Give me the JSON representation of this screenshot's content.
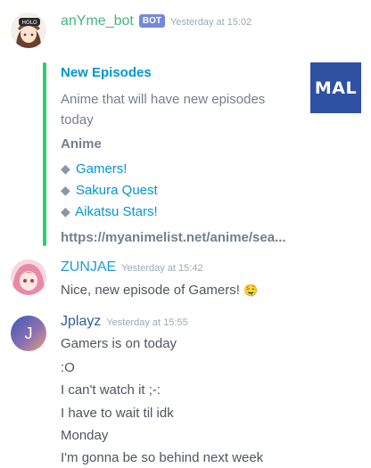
{
  "messages": [
    {
      "username": "anYme_bot",
      "username_color": "#43b581",
      "bot_badge": "BOT",
      "timestamp": "Yesterday at 15:02",
      "embed": {
        "title": "New Episodes",
        "description": "Anime that will have new episodes today",
        "field_name": "Anime",
        "items": [
          "Gamers!",
          "Sakura Quest",
          "Aikatsu Stars!"
        ],
        "item_bullet": "◆",
        "url": "https://myanimelist.net/anime/sea...",
        "thumbnail_text": "MAL",
        "accent_color": "#2ecc71"
      }
    },
    {
      "username": "ZUNJAE",
      "username_color": "#1e9ed8",
      "timestamp": "Yesterday at 15:42",
      "lines": [
        "Nice, new episode of Gamers!"
      ],
      "emoji": "🤤"
    },
    {
      "username": "Jplayz",
      "username_color": "#2c5e9e",
      "avatar_letter": "J",
      "timestamp": "Yesterday at 15:55",
      "lines": [
        "Gamers is on today",
        ":O",
        "I can't watch it ;-:",
        "I have to wait til idk",
        "Monday",
        "I'm gonna be so behind next week"
      ]
    }
  ]
}
